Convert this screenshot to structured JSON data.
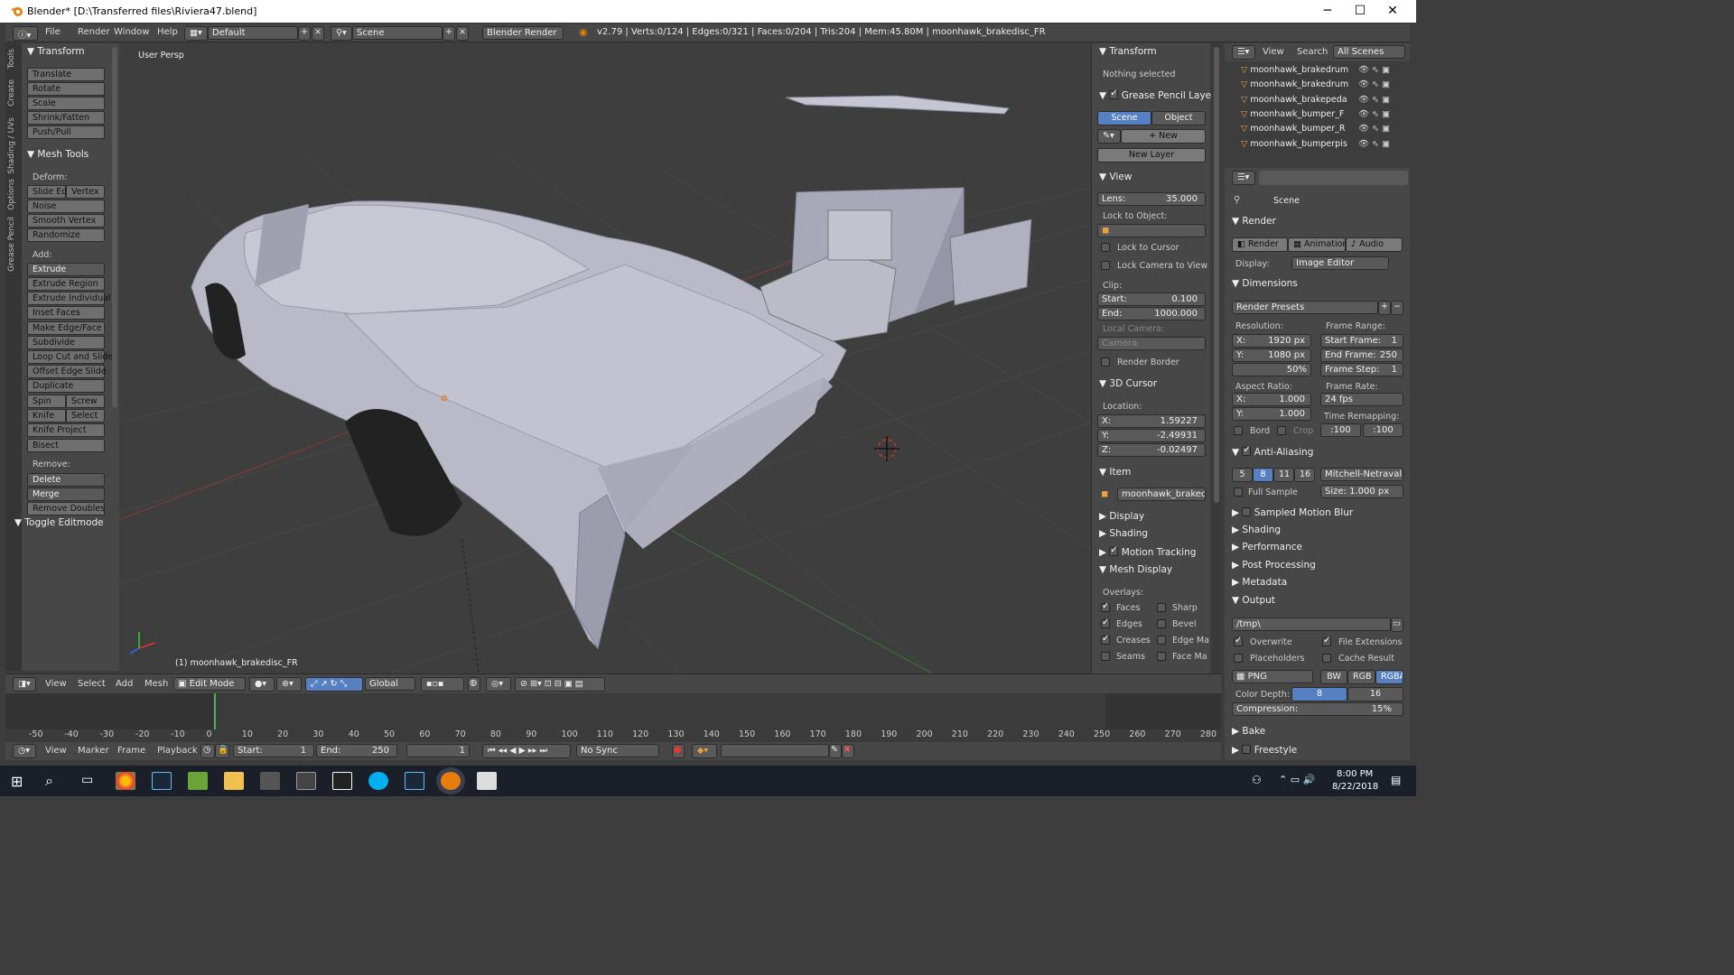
{
  "window": {
    "title": "Blender* [D:\\Transferred files\\Riviera47.blend]",
    "min": "─",
    "max": "☐",
    "close": "✕"
  },
  "info": {
    "menus": [
      "File",
      "Render",
      "Window",
      "Help"
    ],
    "layout": "Default",
    "scene": "Scene",
    "engine": "Blender Render",
    "stats": "v2.79 | Verts:0/124 | Edges:0/321 | Faces:0/204 | Tris:204 | Mem:45.80M | moonhawk_brakedisc_FR"
  },
  "lefttabs": [
    "Tools",
    "Create",
    "Shading / UVs",
    "Options",
    "Grease Pencil"
  ],
  "toolshelf": {
    "transform_title": "Transform",
    "transform": [
      "Translate",
      "Rotate",
      "Scale",
      "Shrink/Fatten",
      "Push/Pull"
    ],
    "meshtools_title": "Mesh Tools",
    "deform_label": "Deform:",
    "slide_edge": "Slide Ed",
    "vertex": "Vertex",
    "noise": "Noise",
    "smooth_vertex": "Smooth Vertex",
    "randomize": "Randomize",
    "add_label": "Add:",
    "extrude": "Extrude",
    "add": [
      "Extrude Region",
      "Extrude Individual",
      "Inset Faces",
      "Make Edge/Face",
      "Subdivide",
      "Loop Cut and Slide",
      "Offset Edge Slide",
      "Duplicate"
    ],
    "spin": "Spin",
    "screw": "Screw",
    "knife": "Knife",
    "select": "Select",
    "knife_project": "Knife Project",
    "bisect": "Bisect",
    "remove_label": "Remove:",
    "delete": "Delete",
    "merge": "Merge",
    "remove_doubles": "Remove Doubles",
    "toggle_editmode": "Toggle Editmode"
  },
  "viewport": {
    "persp": "User Persp",
    "object_label": "(1) moonhawk_brakedisc_FR"
  },
  "npanel": {
    "transform": "Transform",
    "nothing": "Nothing selected",
    "gp_layers": "Grease Pencil Layers",
    "scene": "Scene",
    "object": "Object",
    "new": "New",
    "new_layer": "New Layer",
    "view": "View",
    "lens_label": "Lens:",
    "lens": "35.000",
    "lock_obj": "Lock to Object:",
    "lock_cursor": "Lock to Cursor",
    "lock_cam": "Lock Camera to View",
    "clip": "Clip:",
    "start_label": "Start:",
    "start": "0.100",
    "end_label": "End:",
    "end": "1000.000",
    "local_cam": "Local Camera:",
    "camera": "Camera",
    "render_border": "Render Border",
    "cursor": "3D Cursor",
    "location": "Location:",
    "x_label": "X:",
    "x": "1.59227",
    "y_label": "Y:",
    "y": "-2.49931",
    "z_label": "Z:",
    "z": "-0.02497",
    "item": "Item",
    "item_name": "moonhawk_brakedi...",
    "display": "Display",
    "shading": "Shading",
    "motion": "Motion Tracking",
    "mesh_display": "Mesh Display",
    "overlays": "Overlays:",
    "faces": "Faces",
    "sharp": "Sharp",
    "edges": "Edges",
    "bevel": "Bevel",
    "creases": "Creases",
    "edge_ma": "Edge Ma",
    "seams": "Seams",
    "face_ma": "Face Ma"
  },
  "outliner": {
    "view": "View",
    "search": "Search",
    "all_scenes": "All Scenes",
    "items": [
      "moonhawk_brakedrum",
      "moonhawk_brakedrum",
      "moonhawk_brakepeda",
      "moonhawk_bumper_F",
      "moonhawk_bumper_R",
      "moonhawk_bumperpis"
    ]
  },
  "props": {
    "scene": "Scene",
    "render": "Render",
    "render_btn": "Render",
    "animation_btn": "Animation",
    "audio_btn": "Audio",
    "display_label": "Display:",
    "display": "Image Editor",
    "dimensions": "Dimensions",
    "presets": "Render Presets",
    "resolution": "Resolution:",
    "frame_range": "Frame Range:",
    "res_x": "1920 px",
    "res_y": "1080 px",
    "res_pct": "50%",
    "start_frame_label": "Start Frame:",
    "start_frame": "1",
    "end_frame_label": "End Frame:",
    "end_frame": "250",
    "frame_step_label": "Frame Step:",
    "frame_step": "1",
    "aspect": "Aspect Ratio:",
    "frame_rate": "Frame Rate:",
    "asp_x": "1.000",
    "asp_y": "1.000",
    "fps": "24 fps",
    "bord": "Bord",
    "crop": "Crop",
    "time_remap": "Time Remapping:",
    "remap_old": ":100",
    "remap_new": ":100",
    "x_label": "X:",
    "y_label": "Y:",
    "aa": "Anti-Aliasing",
    "aa_samples": [
      "5",
      "8",
      "11",
      "16"
    ],
    "filter": "Mitchell-Netravali",
    "full_sample": "Full Sample",
    "size": "Size:  1.000 px",
    "sampled_blur": "Sampled Motion Blur",
    "shading": "Shading",
    "performance": "Performance",
    "post": "Post Processing",
    "metadata": "Metadata",
    "output": "Output",
    "path": "/tmp\\",
    "overwrite": "Overwrite",
    "file_ext": "File Extensions",
    "placeholders": "Placeholders",
    "cache": "Cache Result",
    "format": "PNG",
    "bw": "BW",
    "rgb": "RGB",
    "rgba": "RGBA",
    "color_depth": "Color Depth:",
    "depth8": "8",
    "depth16": "16",
    "compression": "Compression:",
    "compression_val": "15%",
    "bake": "Bake",
    "freestyle": "Freestyle"
  },
  "vpheader": {
    "view": "View",
    "select": "Select",
    "add": "Add",
    "mesh": "Mesh",
    "mode": "Edit Mode",
    "orientation": "Global"
  },
  "timeline": {
    "ticks": [
      "-50",
      "-40",
      "-30",
      "-20",
      "-10",
      "0",
      "10",
      "20",
      "30",
      "40",
      "50",
      "60",
      "70",
      "80",
      "90",
      "100",
      "110",
      "120",
      "130",
      "140",
      "150",
      "160",
      "170",
      "180",
      "190",
      "200",
      "210",
      "220",
      "230",
      "240",
      "250",
      "260",
      "270",
      "280"
    ],
    "view": "View",
    "marker": "Marker",
    "frame": "Frame",
    "playback": "Playback",
    "start_label": "Start:",
    "start": "1",
    "end_label": "End:",
    "end": "250",
    "current": "1",
    "sync": "No Sync"
  },
  "taskbar": {
    "time": "8:00 PM",
    "date": "8/22/2018"
  },
  "colors": {
    "accent": "#5680c2",
    "bg": "#3e3e3e",
    "panel": "#474747"
  }
}
